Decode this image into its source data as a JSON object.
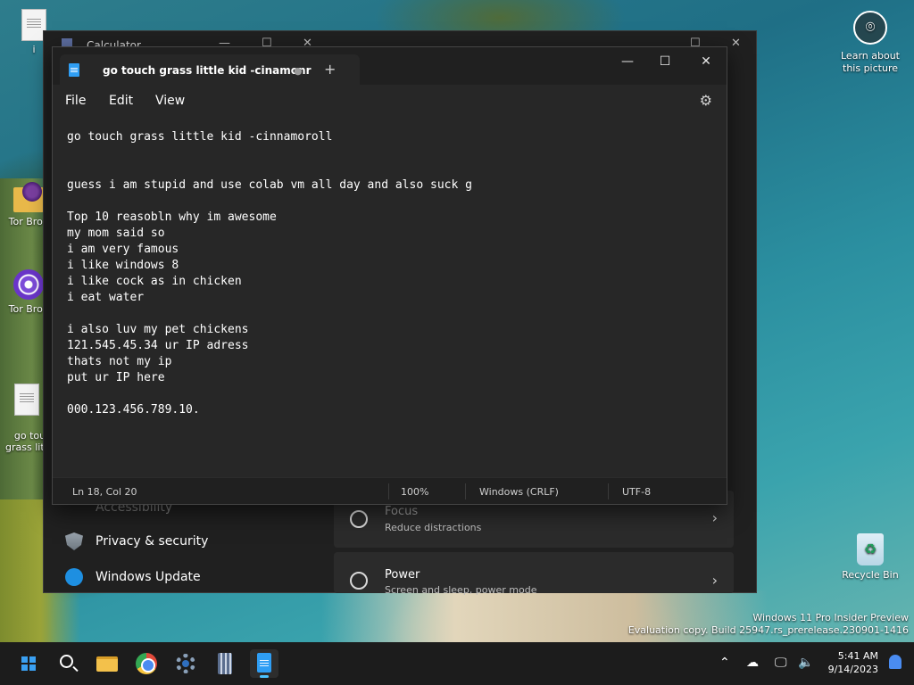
{
  "desktop": {
    "icons": [
      {
        "label": "i"
      },
      {
        "label": "Tor Brov"
      },
      {
        "label": "Tor Brov"
      },
      {
        "label": "go tou\ngrass litt"
      }
    ],
    "learn_about": "Learn about\nthis picture",
    "recycle_bin": "Recycle Bin",
    "watermark_line1": "Windows 11 Pro Insider Preview",
    "watermark_line2": "Evaluation copy. Build 25947.rs_prerelease.230901-1416"
  },
  "calculator": {
    "title": "Calculator"
  },
  "settings": {
    "accessibility": "Accessibility",
    "privacy": "Privacy & security",
    "windows_update": "Windows Update",
    "focus_title": "Focus",
    "focus_sub": "Reduce distractions",
    "power_title": "Power",
    "power_sub": "Screen and sleep, power mode"
  },
  "notepad": {
    "tab_title": "go touch grass little kid -cinamonr",
    "unsaved_dot": "●",
    "new_tab": "+",
    "menu": {
      "file": "File",
      "edit": "Edit",
      "view": "View"
    },
    "content": "go touch grass little kid -cinnamoroll\n\n\nguess i am stupid and use colab vm all day and also suck g\n\nTop 10 reasobln why im awesome\nmy mom said so\ni am very famous\ni like windows 8\ni like cock as in chicken\ni eat water\n\ni also luv my pet chickens\n121.545.45.34 ur IP adress\nthats not my ip\nput ur IP here\n\n000.123.456.789.10.",
    "status": {
      "position": "Ln 18, Col 20",
      "zoom": "100%",
      "line_ending": "Windows (CRLF)",
      "encoding": "UTF-8"
    }
  },
  "taskbar": {
    "time": "5:41 AM",
    "date": "9/14/2023"
  }
}
